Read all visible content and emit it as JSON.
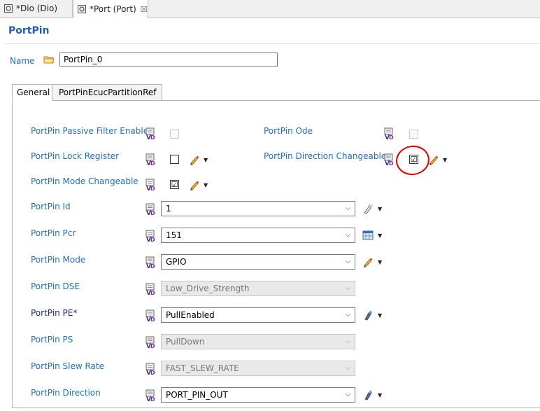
{
  "editor_tabs": [
    {
      "label": "*Dio (Dio)"
    },
    {
      "label": "*Port (Port)",
      "close": "☒"
    }
  ],
  "title": "PortPin",
  "name_field": {
    "label": "Name",
    "value": "PortPin_0"
  },
  "tabs": [
    {
      "label": "General"
    },
    {
      "label": "PortPinEcucPartitionRef"
    }
  ],
  "params": {
    "passive_filter": {
      "label": "PortPin Passive Filter Enable"
    },
    "ode": {
      "label": "PortPin Ode"
    },
    "lock_register": {
      "label": "PortPin Lock Register"
    },
    "direction_changeable": {
      "label": "PortPin Direction Changeable",
      "check": "☑"
    },
    "mode_changeable": {
      "label": "PortPin Mode Changeable",
      "check": "☑"
    },
    "id": {
      "label": "PortPin Id",
      "value": "1"
    },
    "pcr": {
      "label": "PortPin Pcr",
      "value": "151"
    },
    "mode": {
      "label": "PortPin Mode",
      "value": "GPIO"
    },
    "dse": {
      "label": "PortPin DSE",
      "value": "Low_Drive_Strength"
    },
    "pe": {
      "label": "PortPin PE*",
      "value": "PullEnabled"
    },
    "ps": {
      "label": "PortPin PS",
      "value": "PullDown"
    },
    "slew_rate": {
      "label": "PortPin Slew Rate",
      "value": "FAST_SLEW_RATE"
    },
    "direction": {
      "label": "PortPin Direction",
      "value": "PORT_PIN_OUT"
    }
  },
  "colors": {
    "label_blue": "#1f6fb8",
    "title_blue": "#1f5fa8",
    "annotation_red": "#e00000"
  }
}
